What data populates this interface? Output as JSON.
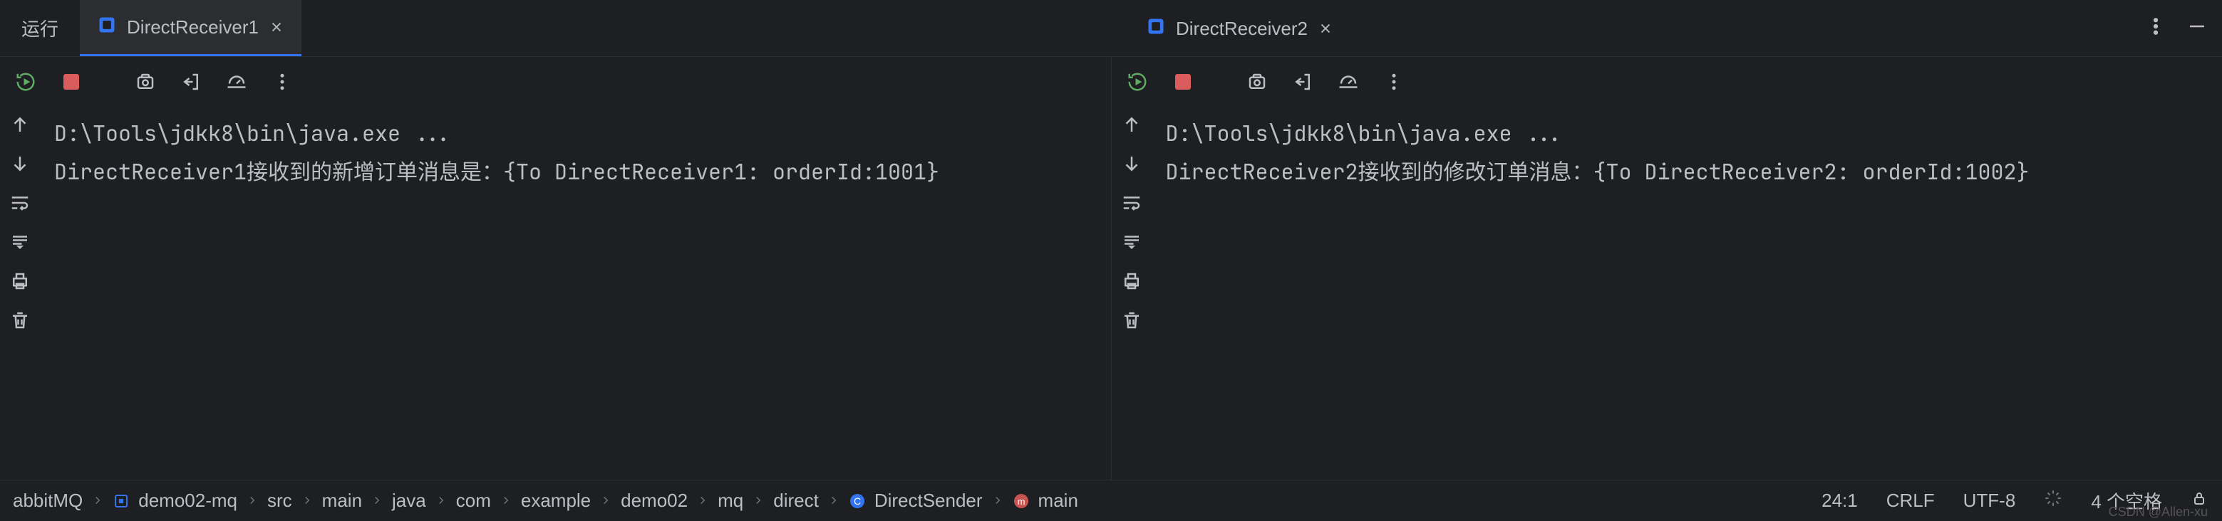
{
  "tabs": {
    "run_label": "运行",
    "tab1_label": "DirectReceiver1",
    "tab2_label": "DirectReceiver2"
  },
  "panes": {
    "left": {
      "console_line1": "D:\\Tools\\jdkk8\\bin\\java.exe ...",
      "console_line2": "DirectReceiver1接收到的新增订单消息是：{To DirectReceiver1: orderId:1001}"
    },
    "right": {
      "console_line1": "D:\\Tools\\jdkk8\\bin\\java.exe ...",
      "console_line2": "DirectReceiver2接收到的修改订单消息：{To DirectReceiver2: orderId:1002}"
    }
  },
  "breadcrumb": {
    "items": [
      "abbitMQ",
      "demo02-mq",
      "src",
      "main",
      "java",
      "com",
      "example",
      "demo02",
      "mq",
      "direct",
      "DirectSender",
      "main"
    ]
  },
  "status": {
    "caret": "24:1",
    "line_sep": "CRLF",
    "encoding": "UTF-8",
    "indent": "4 个空格"
  },
  "watermark": "CSDN @Allen-xu",
  "icons": {
    "file_class": "class-file-icon",
    "close": "close-icon",
    "more_v": "more-vertical-icon",
    "minimize": "minimize-icon",
    "rerun": "rerun-icon",
    "stop": "stop-icon",
    "camera": "camera-icon",
    "exit": "exit-icon",
    "dashboard": "dashboard-icon",
    "up": "arrow-up-icon",
    "down": "arrow-down-icon",
    "wrap": "soft-wrap-icon",
    "scroll": "scroll-to-end-icon",
    "print": "print-icon",
    "trash": "trash-icon",
    "module": "module-icon",
    "class_c": "class-c-icon",
    "method_m": "method-m-icon",
    "chevron": "chevron-right-icon",
    "spinner": "spinner-icon",
    "lock": "lock-icon"
  }
}
